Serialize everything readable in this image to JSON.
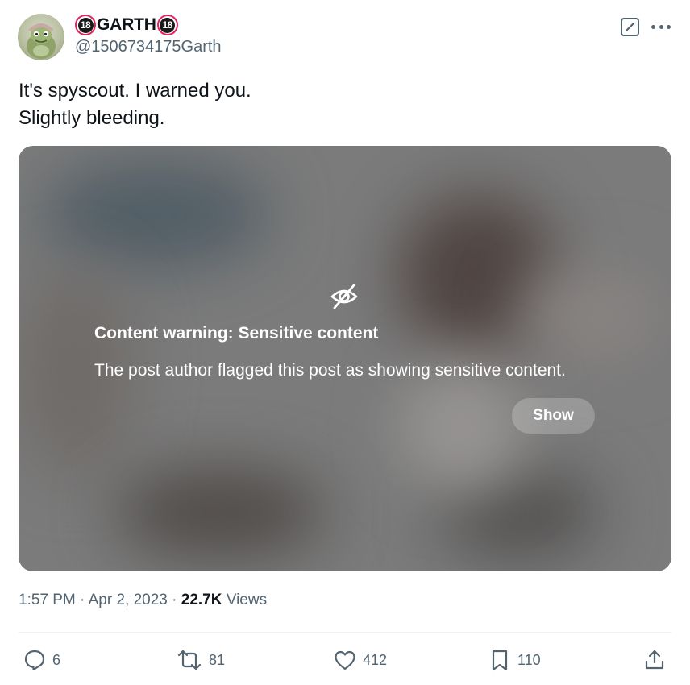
{
  "author": {
    "display_name": "GARTH",
    "badge_text": "18",
    "handle": "@1506734175Garth"
  },
  "tweet": {
    "lines": [
      "It's spyscout. I warned you.",
      "Slightly bleeding."
    ]
  },
  "media": {
    "warning_title": "Content warning: Sensitive content",
    "warning_description": "The post author flagged this post as showing sensitive content.",
    "show_label": "Show"
  },
  "meta": {
    "time": "1:57 PM",
    "separator": "·",
    "date": "Apr 2, 2023",
    "views_count": "22.7K",
    "views_label": "Views"
  },
  "actions": {
    "reply_count": "6",
    "repost_count": "81",
    "like_count": "412",
    "bookmark_count": "110"
  },
  "colors": {
    "text_primary": "#0f1419",
    "text_secondary": "#536471",
    "badge_ring": "#e0245e",
    "media_base": "#7b7b7b"
  },
  "icons": [
    "edit-icon",
    "more-icon",
    "eye-slash-icon",
    "reply-icon",
    "repost-icon",
    "like-icon",
    "bookmark-icon",
    "share-icon"
  ]
}
